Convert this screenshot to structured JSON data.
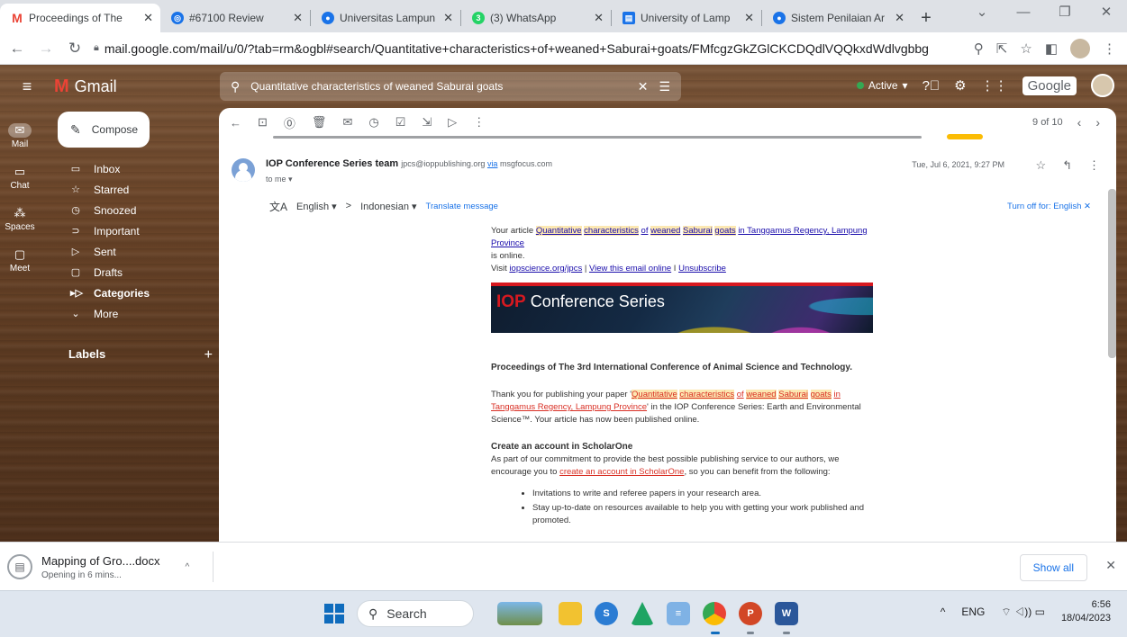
{
  "browser": {
    "tabs": [
      {
        "title": "Proceedings of The",
        "icon": "gmail-icon",
        "color": "#ea4335",
        "active": true
      },
      {
        "title": "#67100 Review",
        "icon": "ojs-icon",
        "color": "#1a73e8",
        "active": false
      },
      {
        "title": "Universitas Lampun",
        "icon": "unila-icon",
        "color": "#1a73e8",
        "active": false
      },
      {
        "title": "(3) WhatsApp",
        "icon": "whatsapp-icon",
        "color": "#25d366",
        "active": false
      },
      {
        "title": "University of Lamp",
        "icon": "doc-icon",
        "color": "#1a73e8",
        "active": false
      },
      {
        "title": "Sistem Penilaian Ar",
        "icon": "unila-icon",
        "color": "#1a73e8",
        "active": false
      }
    ],
    "url": "mail.google.com/mail/u/0/?tab=rm&ogbl#search/Quantitative+characteristics+of+weaned+Saburai+goats/FMfcgzGkZGlCKCDQdlVQQkxdWdlvgbbg"
  },
  "gmail": {
    "app_name": "Gmail",
    "search_query": "Quantitative characteristics of weaned Saburai goats",
    "status": "Active",
    "google_label": "Google",
    "rail": [
      {
        "label": "Mail",
        "glyph": "✉"
      },
      {
        "label": "Chat",
        "glyph": "▭"
      },
      {
        "label": "Spaces",
        "glyph": "⁂"
      },
      {
        "label": "Meet",
        "glyph": "▢"
      }
    ],
    "compose_label": "Compose",
    "nav": [
      {
        "label": "Inbox",
        "glyph": "▭"
      },
      {
        "label": "Starred",
        "glyph": "☆"
      },
      {
        "label": "Snoozed",
        "glyph": "◷"
      },
      {
        "label": "Important",
        "glyph": "⊃"
      },
      {
        "label": "Sent",
        "glyph": "▷"
      },
      {
        "label": "Drafts",
        "glyph": "▢"
      },
      {
        "label": "Categories",
        "glyph": "▸▷"
      },
      {
        "label": "More",
        "glyph": "⌄"
      }
    ],
    "labels_heading": "Labels",
    "pager": "9 of 10"
  },
  "email": {
    "sender_name": "IOP Conference Series team",
    "sender_email": "jpcs@ioppublishing.org",
    "via_text": "via",
    "via_domain": "msgfocus.com",
    "to": "to me",
    "date": "Tue, Jul 6, 2021, 9:27 PM",
    "translate": {
      "from": "English",
      "arrow": ">",
      "to": "Indonesian",
      "action": "Translate message",
      "turn_off": "Turn off for: English"
    },
    "intro_prefix": "Your article",
    "intro_title_words": [
      "Quantitative",
      "characteristics",
      "of",
      "weaned",
      "Saburai",
      "goats",
      "in Tanggamus Regency, Lampung Province"
    ],
    "intro_suffix": "is online.",
    "visit_prefix": "Visit",
    "visit_link": "iopscience.org/jpcs",
    "visit_sep1": "|",
    "view_online": "View this email online",
    "visit_sep2": "I",
    "unsubscribe": "Unsubscribe",
    "banner_iop": "IOP",
    "banner_text": "Conference Series",
    "proceedings": "Proceedings of The 3rd International Conference of Animal Science and Technology.",
    "thanks_prefix": "Thank you for publishing your paper '",
    "thanks_title_words": [
      "Quantitative",
      "characteristics",
      "of",
      "weaned",
      "Saburai",
      "goats",
      "in Tanggamus Regency, Lampung Province"
    ],
    "thanks_suffix": "' in the IOP Conference Series: Earth and Environmental Science™. Your article has now been published online.",
    "account_heading": "Create an account in ScholarOne",
    "account_prefix": "As part of our commitment to provide the best possible publishing service to our authors, we encourage you to",
    "account_link": "create an account in ScholarOne",
    "account_suffix": ", so you can benefit from the following:",
    "bullets": [
      "Invitations to write and referee papers in your research area.",
      "Stay up-to-date on resources available to help you with getting your work published and promoted."
    ]
  },
  "download": {
    "filename": "Mapping of Gro....docx",
    "status": "Opening in 6 mins...",
    "show_all": "Show all"
  },
  "taskbar": {
    "search": "Search",
    "lang": "ENG",
    "time": "6:56",
    "date": "18/04/2023"
  }
}
